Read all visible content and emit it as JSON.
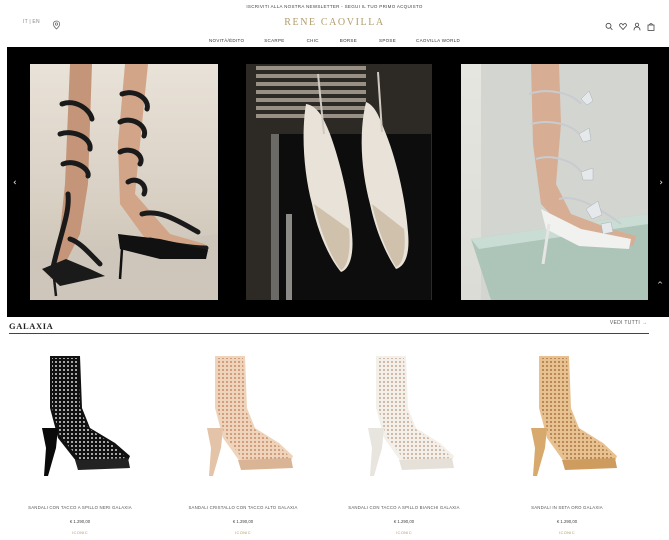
{
  "topbar": {
    "text": "ISCRIVITI ALLA NOSTRA NEWSLETTER - SEGUI IL TUO PRIMO ACQUISTO"
  },
  "header": {
    "language": "IT | EN",
    "brand": "RENE CAOVILLA",
    "icons": [
      "search-icon",
      "heart-icon",
      "user-icon",
      "bag-icon"
    ]
  },
  "nav": {
    "items": [
      {
        "label": "NOVITÀ/ÉDITO"
      },
      {
        "label": "SCARPE"
      },
      {
        "label": "CHIC"
      },
      {
        "label": "BORSE"
      },
      {
        "label": "SPOSE"
      },
      {
        "label": "CAOVILLA WORLD"
      }
    ]
  },
  "hero": {
    "arrow_left": "‹",
    "arrow_right": "›",
    "scroll_up": "^"
  },
  "section": {
    "title": "GALAXIA",
    "view_all": "VEDI TUTTI →"
  },
  "products": [
    {
      "name": "SANDALI CON TACCO A SPILLO NERI GALAXIA",
      "price": "€ 1.290,00",
      "tag": "ICONIC",
      "color": "#111111"
    },
    {
      "name": "SANDALI CRISTALLO CON TACCO ALTO GALAXIA",
      "price": "€ 1.290,00",
      "tag": "ICONIC",
      "color": "#e8c9a8"
    },
    {
      "name": "SANDALI CON TACCO A SPILLO BIANCHI GALAXIA",
      "price": "€ 1.290,00",
      "tag": "ICONIC",
      "color": "#f0ece6"
    },
    {
      "name": "SANDALI IN SETA ORO GALAXIA",
      "price": "€ 1.290,00",
      "tag": "ICONIC",
      "color": "#d9a870"
    }
  ]
}
